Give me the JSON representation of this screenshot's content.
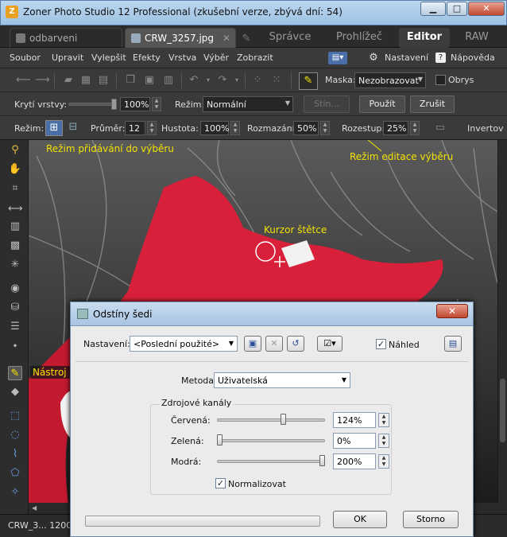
{
  "titlebar": {
    "title": "Zoner Photo Studio 12 Professional (zkušební verze, zbývá dní: 54)"
  },
  "tabs": [
    {
      "label": "odbarveni"
    },
    {
      "label": "CRW_3257.jpg"
    }
  ],
  "modes": [
    "Správce",
    "Prohlížeč",
    "Editor",
    "RAW"
  ],
  "menu": {
    "items": [
      "Soubor",
      "Upravit",
      "Vylepšit",
      "Efekty",
      "Vrstva",
      "Výběr",
      "Zobrazit"
    ],
    "settings": "Nastavení",
    "help": "Nápověda"
  },
  "toolbar1": {
    "mask_label": "Maska:",
    "mask_value": "Nezobrazovat",
    "outline_label": "Obrys"
  },
  "toolbar2": {
    "opacity_label": "Krytí vrstvy:",
    "opacity_value": "100%",
    "mode_label": "Režim:",
    "mode_value": "Normální",
    "stin_label": "Stín...",
    "apply_label": "Použít",
    "cancel_label": "Zrušit"
  },
  "toolbar3": {
    "mode_label": "Režim:",
    "diameter_label": "Průměr:",
    "diameter_value": "12",
    "density_label": "Hustota:",
    "density_value": "100%",
    "blur_label": "Rozmazání:",
    "blur_value": "50%",
    "spacing_label": "Rozestup:",
    "spacing_value": "25%",
    "invert_label": "Invertov"
  },
  "annotations": {
    "add_mode": "Režim přidávání do výběru",
    "edit_mode": "Režim editace výběru",
    "cursor": "Kurzor štětce",
    "brush_tool": "Nástroj štětec"
  },
  "statusbar": {
    "text": "CRW_3... 1200"
  },
  "dialog": {
    "title": "Odstíny šedi",
    "settings_label": "Nastavení:",
    "preset_value": "<Poslední použité>",
    "preview_label": "Náhled",
    "method_label": "Metoda:",
    "method_value": "Uživatelská",
    "group_label": "Zdrojové kanály",
    "channels": [
      {
        "label": "Červená:",
        "value": "124%",
        "level_percent": 124
      },
      {
        "label": "Zelená:",
        "value": "0%",
        "level_percent": 0
      },
      {
        "label": "Modrá:",
        "value": "200%",
        "level_percent": 200
      }
    ],
    "normalize_label": "Normalizovat",
    "ok_label": "OK",
    "cancel_label": "Storno"
  },
  "colors": {
    "annotation": "#f2e200",
    "accent_red": "#d9203a",
    "dialog_bg": "#ebebeb"
  }
}
